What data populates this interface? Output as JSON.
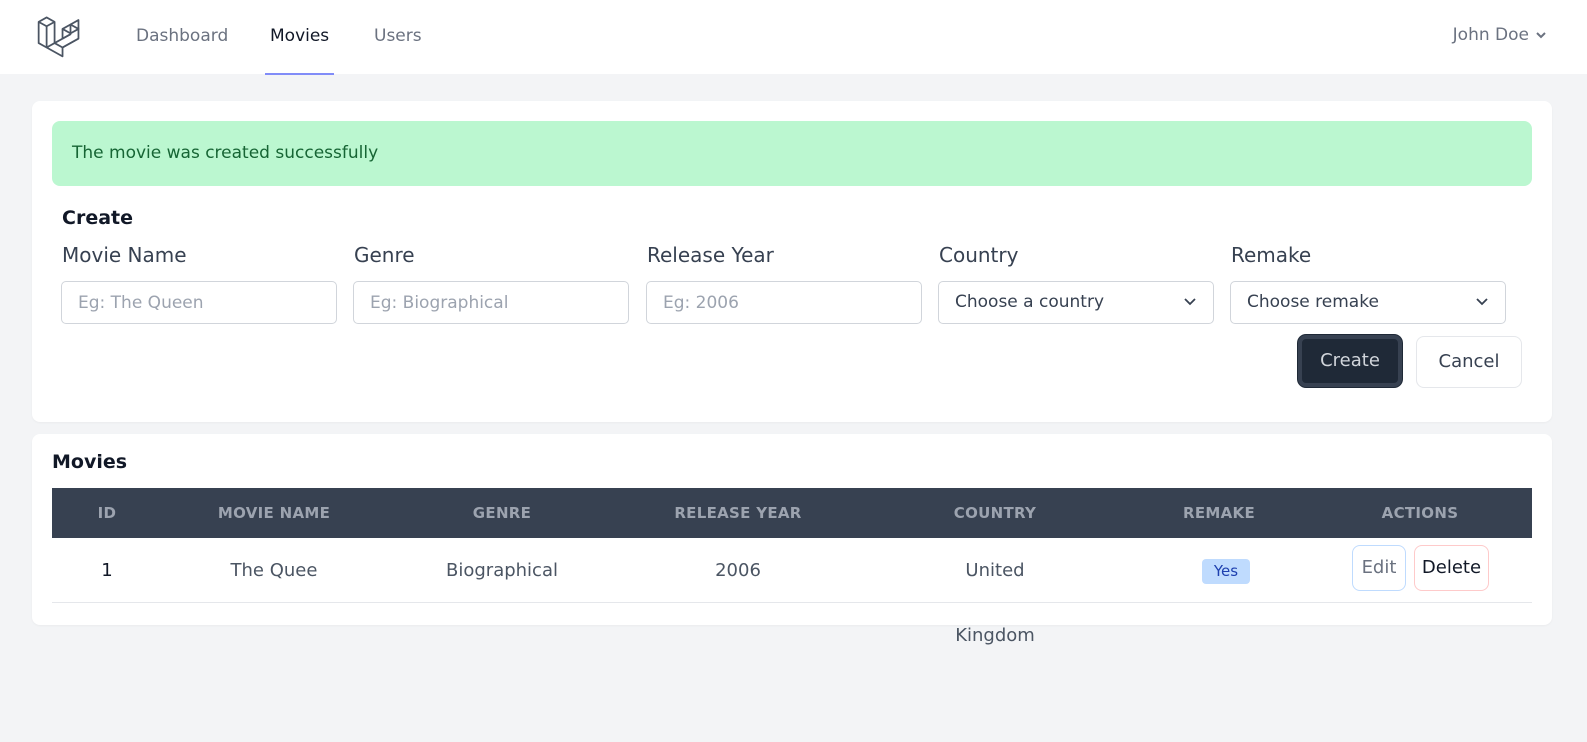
{
  "nav": {
    "links": [
      {
        "label": "Dashboard"
      },
      {
        "label": "Movies"
      },
      {
        "label": "Users"
      }
    ],
    "active": "Movies",
    "user": "John Doe"
  },
  "alert": {
    "message": "The movie was created successfully"
  },
  "create_form": {
    "title": "Create",
    "fields": [
      {
        "label": "Movie Name",
        "placeholder": "Eg: The Queen"
      },
      {
        "label": "Genre",
        "placeholder": "Eg: Biographical"
      },
      {
        "label": "Release Year",
        "placeholder": "Eg: 2006"
      },
      {
        "label": "Country",
        "selected": "Choose a country"
      },
      {
        "label": "Remake",
        "selected": "Choose remake"
      }
    ],
    "submit_label": "Create",
    "cancel_label": "Cancel"
  },
  "movies": {
    "title": "Movies",
    "columns": [
      "ID",
      "MOVIE NAME",
      "GENRE",
      "RELEASE YEAR",
      "COUNTRY",
      "REMAKE",
      "ACTIONS"
    ],
    "rows": [
      {
        "id": "1",
        "name": "The Quee",
        "genre": "Biographical",
        "year": "2006",
        "country": "United Kingdom",
        "remake": "Yes",
        "edit_label": "Edit",
        "delete_label": "Delete"
      }
    ]
  },
  "colors": {
    "accent": "#818cf8",
    "success_bg": "#bbf7d0",
    "dark_button": "#1f2937",
    "table_header": "#374151"
  }
}
